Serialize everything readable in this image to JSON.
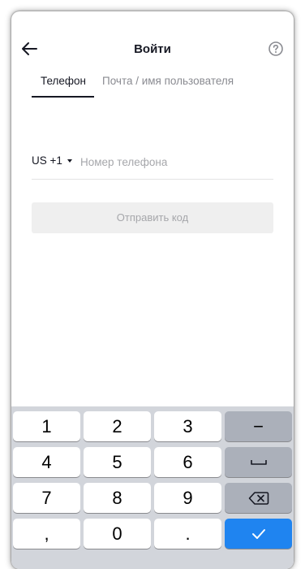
{
  "header": {
    "title": "Войти",
    "back_icon": "arrow-left-icon",
    "help_icon": "question-circle-icon"
  },
  "tabs": [
    {
      "label": "Телефон",
      "active": true
    },
    {
      "label": "Почта / имя пользователя",
      "active": false
    }
  ],
  "phone_form": {
    "country_code": "US +1",
    "placeholder": "Номер телефона",
    "value": ""
  },
  "send_button": {
    "label": "Отправить код",
    "enabled": false
  },
  "keyboard": {
    "keys": [
      "1",
      "2",
      "3",
      "4",
      "5",
      "6",
      "7",
      "8",
      "9",
      ",",
      "0",
      "."
    ],
    "minus": "−",
    "space_icon": "space-icon",
    "backspace_icon": "backspace-icon",
    "enter_icon": "checkmark-icon"
  },
  "colors": {
    "text": "#161823",
    "muted": "#8a8b91",
    "keyboard_bg": "#d2d5db",
    "function_key": "#abb0ba",
    "enter_key": "#1f84f0"
  }
}
